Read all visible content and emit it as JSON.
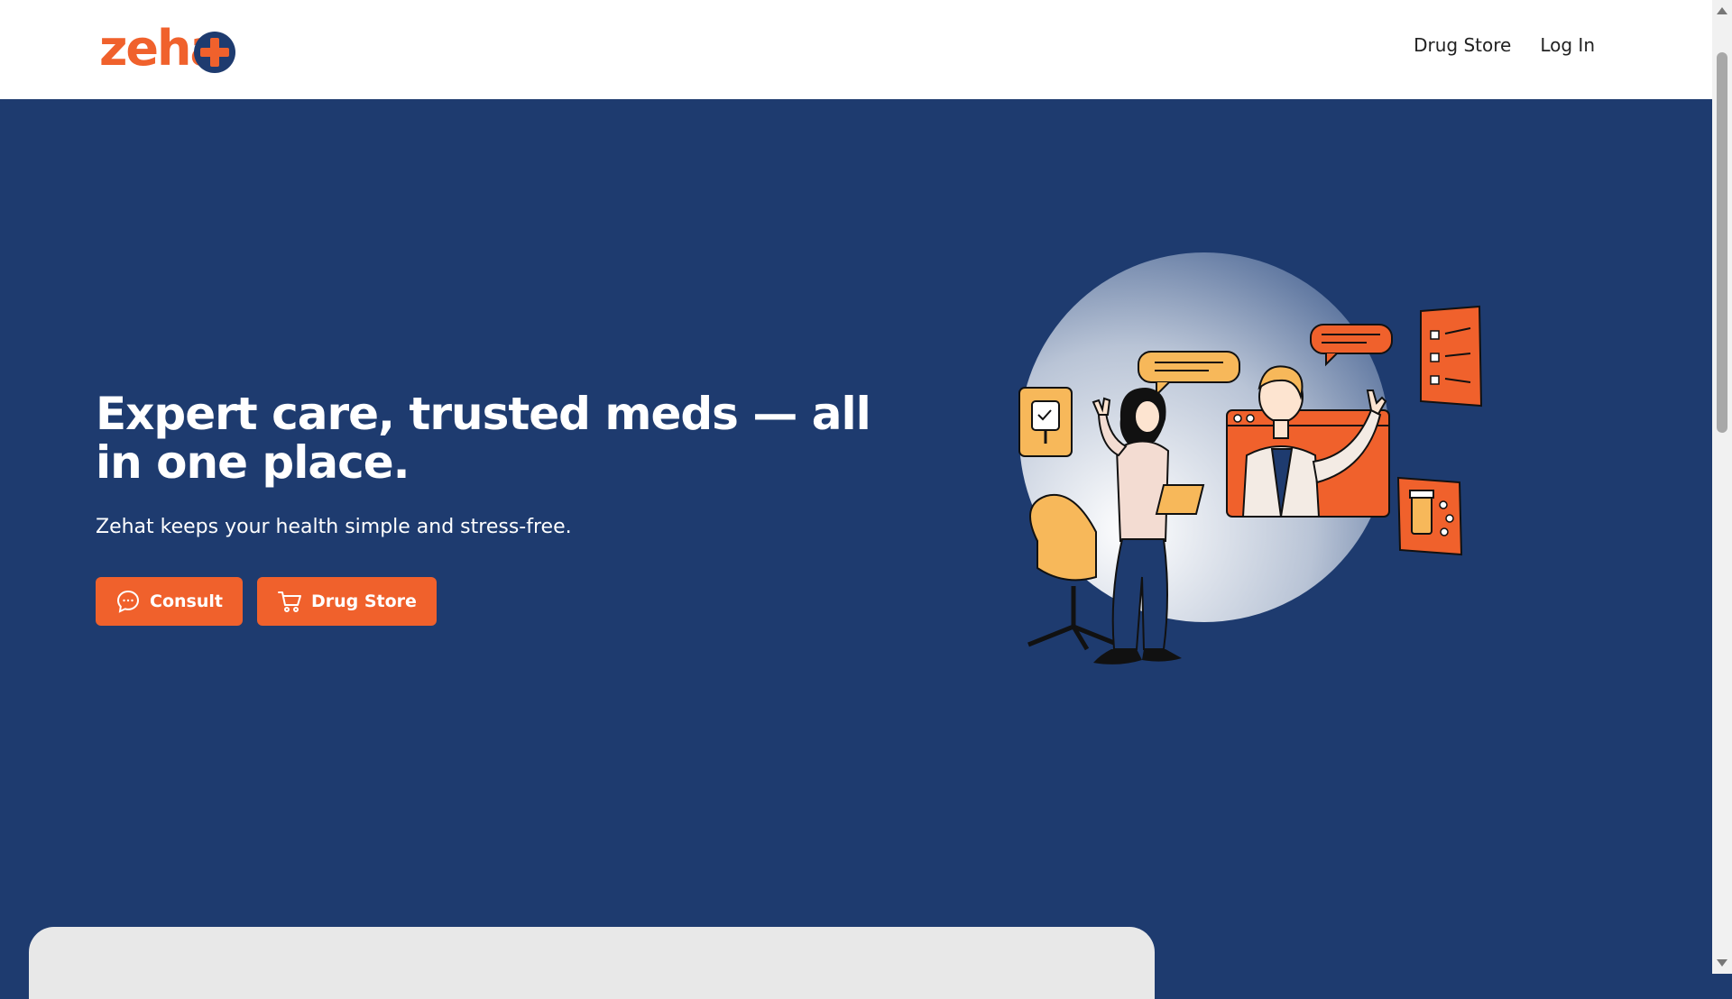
{
  "brand": {
    "logo_text": "zeha"
  },
  "nav": {
    "drug_store": "Drug Store",
    "log_in": "Log In"
  },
  "hero": {
    "title": "Expert care, trusted meds — all in one place.",
    "subtitle": "Zehat keeps your health simple and stress-free.",
    "consult_label": "Consult",
    "drugstore_label": "Drug Store"
  },
  "icons": {
    "consult": "chat-bubble-icon",
    "drugstore": "shopping-cart-icon",
    "logo_plus": "medical-plus-icon"
  },
  "colors": {
    "primary": "#1e3b6f",
    "accent": "#f0612c",
    "accent_light": "#f7b85a"
  }
}
